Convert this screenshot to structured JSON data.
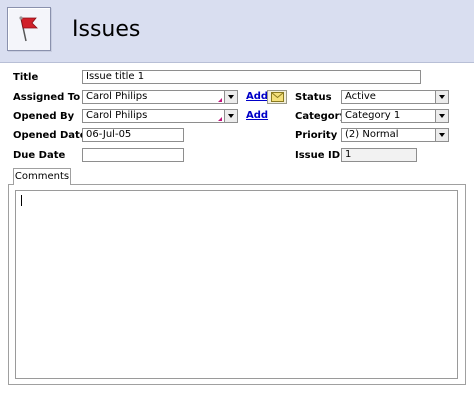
{
  "header": {
    "title": "Issues",
    "logo_icon": "red-flag-icon"
  },
  "form": {
    "title": {
      "label": "Title",
      "value": "Issue title 1"
    },
    "assigned_to": {
      "label": "Assigned To",
      "value": "Carol Philips",
      "add_label": "Add",
      "mail_icon": "envelope-icon"
    },
    "opened_by": {
      "label": "Opened By",
      "value": "Carol Philips",
      "add_label": "Add"
    },
    "opened_date": {
      "label": "Opened Date",
      "value": "06-Jul-05"
    },
    "due_date": {
      "label": "Due Date",
      "value": ""
    },
    "status": {
      "label": "Status",
      "value": "Active"
    },
    "category": {
      "label": "Category",
      "value": "Category 1"
    },
    "priority": {
      "label": "Priority",
      "value": "(2) Normal"
    },
    "issue_id": {
      "label": "Issue ID",
      "value": "1"
    }
  },
  "tabs": {
    "comments": "Comments"
  },
  "comments": {
    "value": ""
  },
  "colors": {
    "header_bg": "#d9def0",
    "link": "#0000c8",
    "flag": "#d0202a"
  }
}
